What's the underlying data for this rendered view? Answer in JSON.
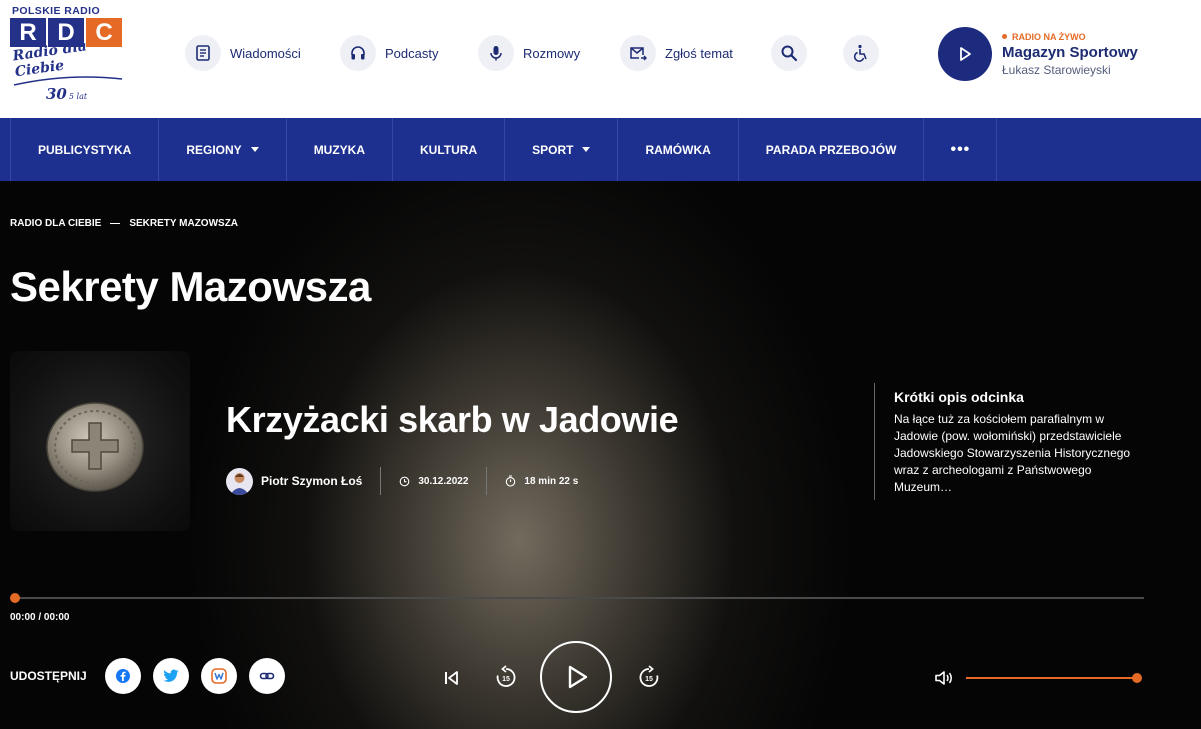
{
  "logo": {
    "top_text": "POLSKIE RADIO",
    "letters": [
      "R",
      "D",
      "C"
    ],
    "script": "Radio dla Ciebie",
    "anniversary_number": "30",
    "anniversary_suffix": "5 lat"
  },
  "topnav": [
    {
      "label": "Wiadomości",
      "icon": "news-icon"
    },
    {
      "label": "Podcasty",
      "icon": "headphones-icon"
    },
    {
      "label": "Rozmowy",
      "icon": "microphone-icon"
    },
    {
      "label": "Zgłoś temat",
      "icon": "mail-send-icon"
    }
  ],
  "live": {
    "tag": "RADIO NA ŻYWO",
    "title": "Magazyn Sportowy",
    "host": "Łukasz Starowieyski"
  },
  "mainnav": [
    "PUBLICYSTYKA",
    "REGIONY",
    "MUZYKA",
    "KULTURA",
    "SPORT",
    "RAMÓWKA",
    "PARADA PRZEBOJÓW"
  ],
  "mainnav_more": "•••",
  "breadcrumb": [
    "RADIO DLA CIEBIE",
    "SEKRETY MAZOWSZA"
  ],
  "page_title": "Sekrety Mazowsza",
  "episode": {
    "title": "Krzyżacki skarb w Jadowie",
    "author": "Piotr Szymon Łoś",
    "date": "30.12.2022",
    "duration": "18 min 22 s"
  },
  "description": {
    "title": "Krótki opis odcinka",
    "body": "Na łące tuż za kościołem parafialnym w Jadowie (pow. wołomiński) przedstawiciele Jadowskiego Stowarzyszenia Historycznego wraz z archeologami z Państwowego Muzeum…"
  },
  "player": {
    "timecode": "00:00 / 00:00",
    "progress": 0,
    "volume": 1.0,
    "skip_seconds": "15"
  },
  "share": {
    "label": "UDOSTĘPNIJ"
  },
  "colors": {
    "brand_blue": "#1d2f8f",
    "accent_orange": "#e46a26"
  }
}
